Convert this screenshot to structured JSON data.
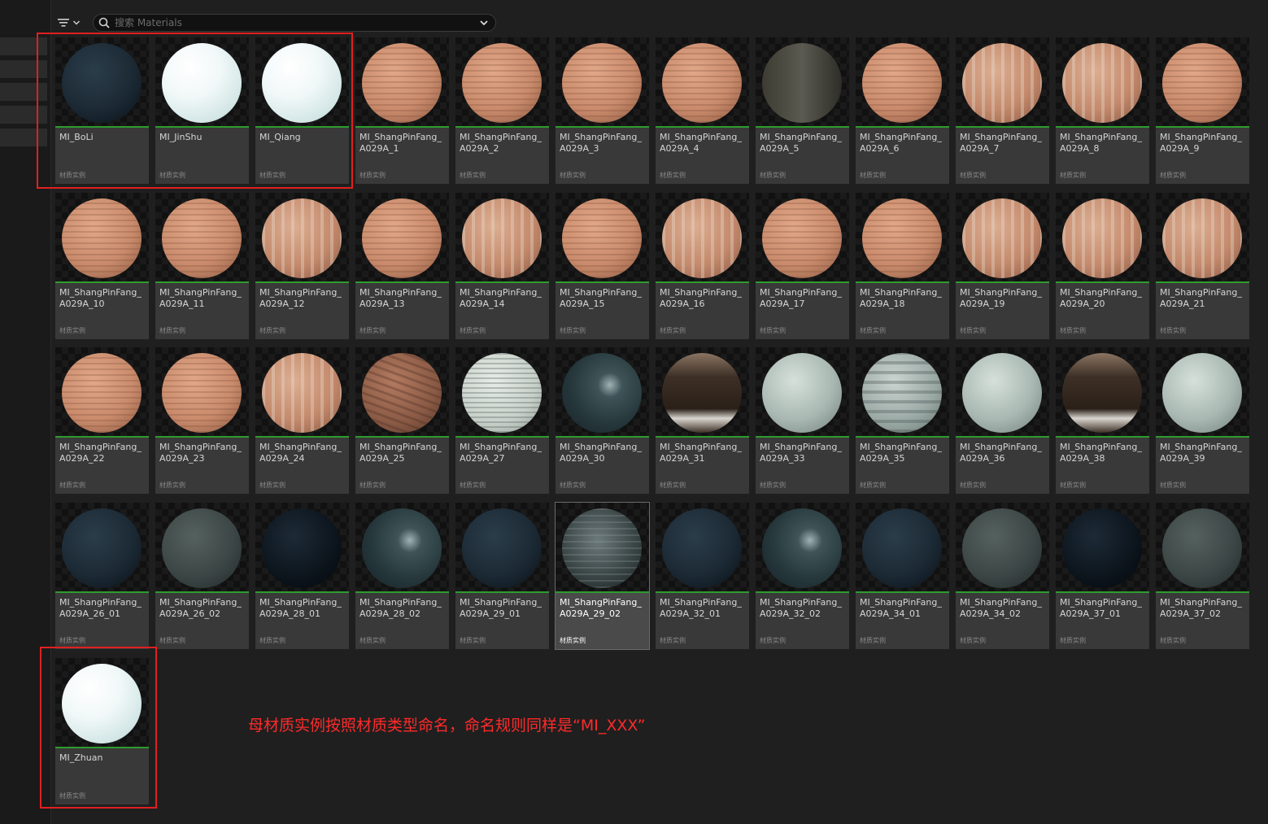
{
  "toolbar": {
    "search_placeholder": "搜索 Materials"
  },
  "tile_type_label": "材质实例",
  "assets": [
    {
      "name": "MI_BoLi",
      "type": "材质实例",
      "look": "dark-glass"
    },
    {
      "name": "MI_JinShu",
      "type": "材质实例",
      "look": "white"
    },
    {
      "name": "MI_Qiang",
      "type": "材质实例",
      "look": "white"
    },
    {
      "name": "MI_ShangPinFang_A029A_1",
      "type": "材质实例",
      "look": "wood"
    },
    {
      "name": "MI_ShangPinFang_A029A_2",
      "type": "材质实例",
      "look": "wood"
    },
    {
      "name": "MI_ShangPinFang_A029A_3",
      "type": "材质实例",
      "look": "wood"
    },
    {
      "name": "MI_ShangPinFang_A029A_4",
      "type": "材质实例",
      "look": "wood"
    },
    {
      "name": "MI_ShangPinFang_A029A_5",
      "type": "材质实例",
      "look": "dark-stone"
    },
    {
      "name": "MI_ShangPinFang_A029A_6",
      "type": "材质实例",
      "look": "wood"
    },
    {
      "name": "MI_ShangPinFang_A029A_7",
      "type": "材质实例",
      "look": "wood-stripe"
    },
    {
      "name": "MI_ShangPinFang_A029A_8",
      "type": "材质实例",
      "look": "wood-stripe"
    },
    {
      "name": "MI_ShangPinFang_A029A_9",
      "type": "材质实例",
      "look": "wood"
    },
    {
      "name": "MI_ShangPinFang_A029A_10",
      "type": "材质实例",
      "look": "wood"
    },
    {
      "name": "MI_ShangPinFang_A029A_11",
      "type": "材质实例",
      "look": "wood"
    },
    {
      "name": "MI_ShangPinFang_A029A_12",
      "type": "材质实例",
      "look": "wood-stripe"
    },
    {
      "name": "MI_ShangPinFang_A029A_13",
      "type": "材质实例",
      "look": "wood"
    },
    {
      "name": "MI_ShangPinFang_A029A_14",
      "type": "材质实例",
      "look": "wood-stripe"
    },
    {
      "name": "MI_ShangPinFang_A029A_15",
      "type": "材质实例",
      "look": "wood"
    },
    {
      "name": "MI_ShangPinFang_A029A_16",
      "type": "材质实例",
      "look": "wood-stripe"
    },
    {
      "name": "MI_ShangPinFang_A029A_17",
      "type": "材质实例",
      "look": "wood"
    },
    {
      "name": "MI_ShangPinFang_A029A_18",
      "type": "材质实例",
      "look": "wood"
    },
    {
      "name": "MI_ShangPinFang_A029A_19",
      "type": "材质实例",
      "look": "wood-stripe"
    },
    {
      "name": "MI_ShangPinFang_A029A_20",
      "type": "材质实例",
      "look": "wood-stripe"
    },
    {
      "name": "MI_ShangPinFang_A029A_21",
      "type": "材质实例",
      "look": "wood-stripe"
    },
    {
      "name": "MI_ShangPinFang_A029A_22",
      "type": "材质实例",
      "look": "wood"
    },
    {
      "name": "MI_ShangPinFang_A029A_23",
      "type": "材质实例",
      "look": "wood"
    },
    {
      "name": "MI_ShangPinFang_A029A_24",
      "type": "材质实例",
      "look": "wood-stripe"
    },
    {
      "name": "MI_ShangPinFang_A029A_25",
      "type": "材质实例",
      "look": "brown"
    },
    {
      "name": "MI_ShangPinFang_A029A_27",
      "type": "材质实例",
      "look": "marble"
    },
    {
      "name": "MI_ShangPinFang_A029A_30",
      "type": "材质实例",
      "look": "dark-teal"
    },
    {
      "name": "MI_ShangPinFang_A029A_31",
      "type": "材质实例",
      "look": "dark-brown"
    },
    {
      "name": "MI_ShangPinFang_A029A_33",
      "type": "材质实例",
      "look": "grey-green"
    },
    {
      "name": "MI_ShangPinFang_A029A_35",
      "type": "材质实例",
      "look": "grey-stripe"
    },
    {
      "name": "MI_ShangPinFang_A029A_36",
      "type": "材质实例",
      "look": "grey-green"
    },
    {
      "name": "MI_ShangPinFang_A029A_38",
      "type": "材质实例",
      "look": "dark-brown"
    },
    {
      "name": "MI_ShangPinFang_A029A_39",
      "type": "材质实例",
      "look": "grey-green"
    },
    {
      "name": "MI_ShangPinFang_A029A_26_01",
      "type": "材质实例",
      "look": "dark-glass"
    },
    {
      "name": "MI_ShangPinFang_A029A_26_02",
      "type": "材质实例",
      "look": "dark-grey"
    },
    {
      "name": "MI_ShangPinFang_A029A_28_01",
      "type": "材质实例",
      "look": "black-glass"
    },
    {
      "name": "MI_ShangPinFang_A029A_28_02",
      "type": "材质实例",
      "look": "dark-teal"
    },
    {
      "name": "MI_ShangPinFang_A029A_29_01",
      "type": "材质实例",
      "look": "dark-glass"
    },
    {
      "name": "MI_ShangPinFang_A029A_29_02",
      "type": "材质实例",
      "look": "dark-metal",
      "selected": true
    },
    {
      "name": "MI_ShangPinFang_A029A_32_01",
      "type": "材质实例",
      "look": "dark-glass"
    },
    {
      "name": "MI_ShangPinFang_A029A_32_02",
      "type": "材质实例",
      "look": "dark-teal"
    },
    {
      "name": "MI_ShangPinFang_A029A_34_01",
      "type": "材质实例",
      "look": "dark-glass"
    },
    {
      "name": "MI_ShangPinFang_A029A_34_02",
      "type": "材质实例",
      "look": "dark-grey"
    },
    {
      "name": "MI_ShangPinFang_A029A_37_01",
      "type": "材质实例",
      "look": "black-glass"
    },
    {
      "name": "MI_ShangPinFang_A029A_37_02",
      "type": "材质实例",
      "look": "dark-grey"
    },
    {
      "name": "MI_Zhuan",
      "type": "材质实例",
      "look": "white"
    }
  ],
  "annotation": {
    "text": "母材质实例按照材质类型命名，命名规则同样是“MI_XXX”"
  },
  "colors": {
    "highlight": "#e02020",
    "annotation": "#ff2a2a",
    "asset_bar": "#2e9b2e"
  }
}
